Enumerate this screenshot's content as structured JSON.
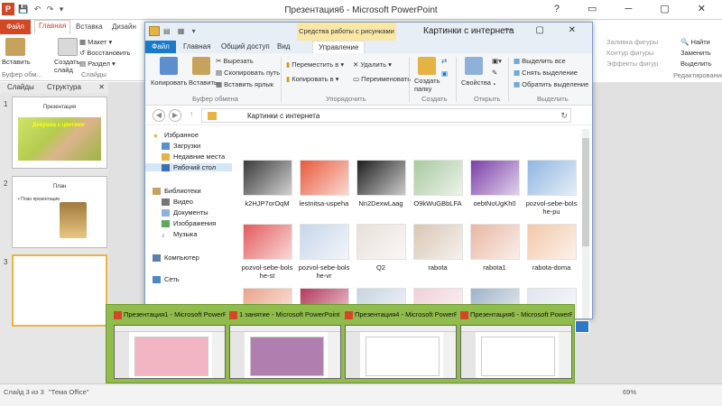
{
  "ppt": {
    "title": "Презентация6 - Microsoft PowerPoint",
    "logo": "P",
    "tabs": [
      "Файл",
      "Главная",
      "Вставка",
      "Дизайн"
    ],
    "ribbon": {
      "paste": "Вставить",
      "create_slide": "Создать\nслайд",
      "layout": "Макет",
      "restore": "Восстановить",
      "section": "Раздел",
      "clipboard_group": "Буфер обм...",
      "slides_group": "Слайды",
      "shape_fill": "Заливка фигуры",
      "shape_outline": "Контур фигуры",
      "shape_effects": "Эффекты фигур",
      "find": "Найти",
      "replace": "Заменить",
      "select": "Выделить",
      "editing_group": "Редактирование"
    },
    "panel_tabs": [
      "Слайды",
      "Структура"
    ],
    "slides": [
      {
        "num": "1",
        "title": "Презентация",
        "caption": "Девушка с цветами"
      },
      {
        "num": "2",
        "title": "План",
        "bullet": "• План презентации"
      },
      {
        "num": "3"
      }
    ],
    "status": {
      "slide": "Слайд 3 из 3",
      "theme": "\"Тема Office\"",
      "zoom": "69%"
    }
  },
  "explorer": {
    "context_label": "Средства работы с рисунками",
    "title": "Картинки с интернета",
    "tabs": [
      "Файл",
      "Главная",
      "Общий доступ",
      "Вид",
      "Управление"
    ],
    "ribbon": {
      "copy": "Копировать",
      "paste": "Вставить",
      "cut": "Вырезать",
      "copy_path": "Скопировать путь",
      "paste_shortcut": "Вставить ярлык",
      "clipboard_group": "Буфер обмена",
      "move_to": "Переместить в ▾",
      "copy_to": "Копировать в ▾",
      "delete": "✕ Удалить ▾",
      "rename": "Переименовать",
      "organize_group": "Упорядочить",
      "new_folder": "Создать\nпапку",
      "create_group": "Создать",
      "properties": "Свойства",
      "open_group": "Открыть",
      "select_all": "Выделить все",
      "select_none": "Снять выделение",
      "invert_selection": "Обратить выделение",
      "select_group": "Выделить"
    },
    "address": "Картинки с интернета",
    "nav": {
      "favorites": "Избранное",
      "downloads": "Загрузки",
      "recent": "Недавние места",
      "desktop": "Рабочий стол",
      "libraries": "Библиотеки",
      "video": "Видео",
      "documents": "Документы",
      "images": "Изображения",
      "music": "Музыка",
      "computer": "Компьютер",
      "network": "Сеть"
    },
    "files": [
      {
        "name": "k2HJP7orOqM",
        "color": "#3a3a3a"
      },
      {
        "name": "lestnitsa-uspeha",
        "color": "#e85a3c"
      },
      {
        "name": "Nn2DexwLaag",
        "color": "#1e1e1e"
      },
      {
        "name": "O9kWuGBbLFA",
        "color": "#a9c9a0"
      },
      {
        "name": "oebtNoUgKh0",
        "color": "#7b3fa8"
      },
      {
        "name": "pozvol-sebe-bols\nhe-pu",
        "color": "#8fb6e0"
      },
      {
        "name": "pozvol-sebe-bols\nhe-st",
        "color": "#e35b5b"
      },
      {
        "name": "pozvol-sebe-bols\nhe-vr",
        "color": "#c7d6ea"
      },
      {
        "name": "Q2",
        "color": "#e8e0d8"
      },
      {
        "name": "rabota",
        "color": "#d8c6b4"
      },
      {
        "name": "rabota1",
        "color": "#e8b7a2"
      },
      {
        "name": "rabota-doma",
        "color": "#f2c8a8"
      },
      {
        "name": "",
        "color": "#e9a48a"
      },
      {
        "name": "",
        "color": "#b43a5c"
      },
      {
        "name": "",
        "color": "#c8d4e0"
      },
      {
        "name": "",
        "color": "#f0d0d8"
      },
      {
        "name": "",
        "color": "#9fb3c8"
      },
      {
        "name": "",
        "color": "#e0e6ee"
      }
    ]
  },
  "taskbar_preview": [
    {
      "label": "Презентация1 - Microsoft PowerPoint",
      "accent": "#f2b5c4"
    },
    {
      "label": "1 занятие - Microsoft PowerPoint",
      "accent": "#b07fb0"
    },
    {
      "label": "Презентация4 - Microsoft PowerPoint",
      "accent": "#ffffff"
    },
    {
      "label": "Презентация6 - Microsoft PowerPoint",
      "accent": "#ffffff"
    }
  ]
}
